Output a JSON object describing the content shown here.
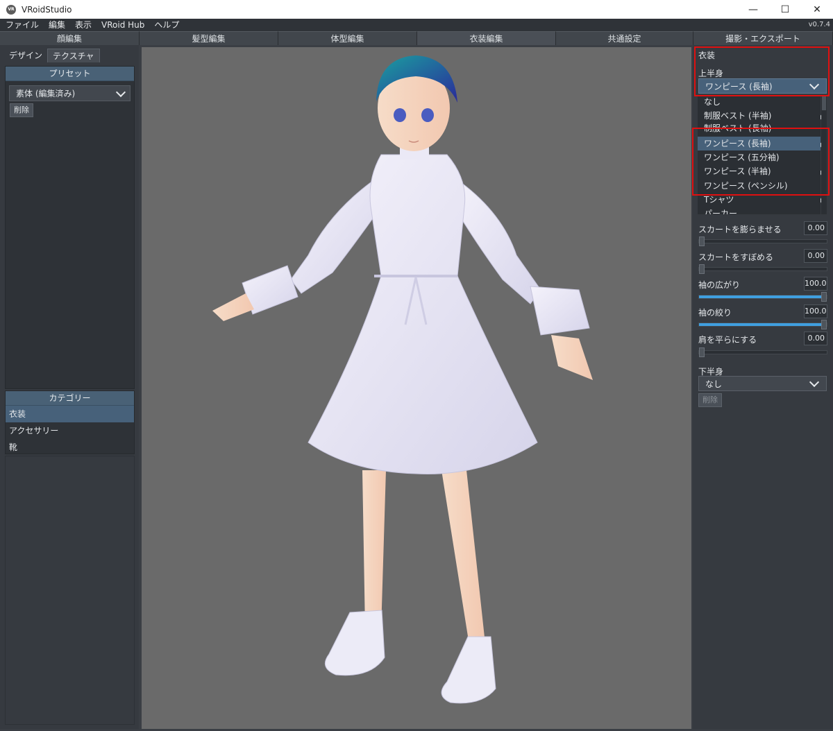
{
  "window": {
    "title": "VRoidStudio",
    "icon": "vroid-logo-icon",
    "minimize": "—",
    "maximize": "☐",
    "close": "✕"
  },
  "menu": {
    "items": [
      "ファイル",
      "編集",
      "表示",
      "VRoid Hub",
      "ヘルプ"
    ],
    "version": "v0.7.4"
  },
  "top_tabs": [
    "顔編集",
    "髪型編集",
    "体型編集",
    "衣装編集",
    "共通設定",
    "撮影・エクスポート"
  ],
  "left": {
    "sub_tabs": [
      "デザイン",
      "テクスチャ"
    ],
    "preset_header": "プリセット",
    "preset_value": "素体 (編集済み)",
    "delete_label": "削除",
    "category_header": "カテゴリー",
    "categories": [
      "衣装",
      "アクセサリー",
      "靴"
    ]
  },
  "right": {
    "section_title": "衣装",
    "upper_label": "上半身",
    "upper_value": "ワンピース (長袖)",
    "upper_options": [
      "なし",
      "制服ベスト (半袖)",
      "制服ベスト (長袖)",
      "ワンピース (長袖)",
      "ワンピース (五分袖)",
      "ワンピース (半袖)",
      "ワンピース (ペンシル)",
      "Tシャツ",
      "パーカー"
    ],
    "behind_values": [
      "0",
      "0",
      "0",
      "0",
      "0"
    ],
    "sliders": [
      {
        "label": "スカートを膨らませる",
        "value": "0.00",
        "level": 0
      },
      {
        "label": "スカートをすぼめる",
        "value": "0.00",
        "level": 0
      },
      {
        "label": "袖の広がり",
        "value": "100.0",
        "level": 1
      },
      {
        "label": "袖の絞り",
        "value": "100.0",
        "level": 1
      },
      {
        "label": "肩を平らにする",
        "value": "0.00",
        "level": 0
      }
    ],
    "lower_label": "下半身",
    "lower_value": "なし",
    "lower_delete": "削除"
  },
  "colors": {
    "accent": "#47617a",
    "slider": "#3f9fe0",
    "highlight_box": "#e01010",
    "viewport": "#6a6a6a"
  }
}
